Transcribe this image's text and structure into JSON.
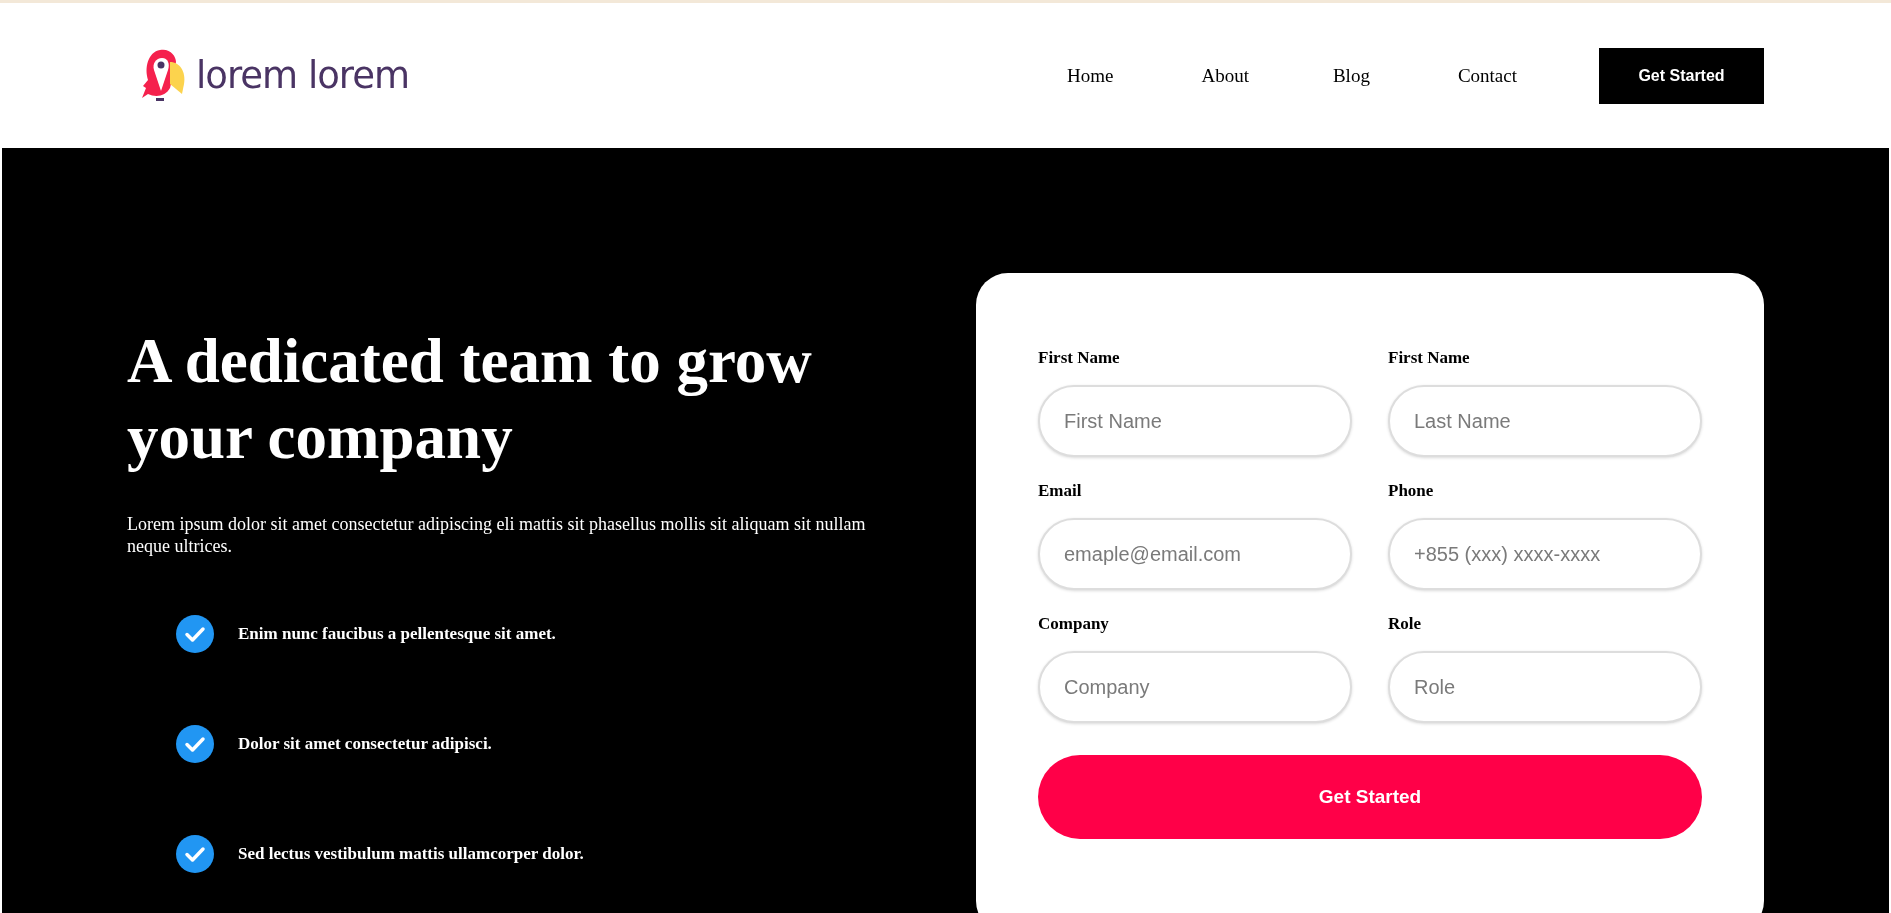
{
  "header": {
    "logo_text": "lorem lorem",
    "nav": [
      {
        "label": "Home"
      },
      {
        "label": "About"
      },
      {
        "label": "Blog"
      },
      {
        "label": "Contact"
      }
    ],
    "cta": "Get Started"
  },
  "hero": {
    "title": "A dedicated team to grow your company",
    "text": "Lorem ipsum dolor sit amet consectetur adipiscing eli mattis sit phasellus mollis sit aliquam sit nullam neque ultrices.",
    "features": [
      "Enim nunc faucibus a pellentesque sit amet.",
      "Dolor sit amet consectetur adipisci.",
      "Sed lectus vestibulum mattis ullamcorper dolor."
    ]
  },
  "form": {
    "fields": [
      {
        "label": "First Name",
        "placeholder": "First Name"
      },
      {
        "label": "First Name",
        "placeholder": "Last Name"
      },
      {
        "label": "Email",
        "placeholder": "emaple@email.com"
      },
      {
        "label": "Phone",
        "placeholder": "+855 (xxx) xxxx-xxxx"
      },
      {
        "label": "Company",
        "placeholder": "Company"
      },
      {
        "label": "Role",
        "placeholder": "Role"
      }
    ],
    "submit": "Get Started"
  }
}
